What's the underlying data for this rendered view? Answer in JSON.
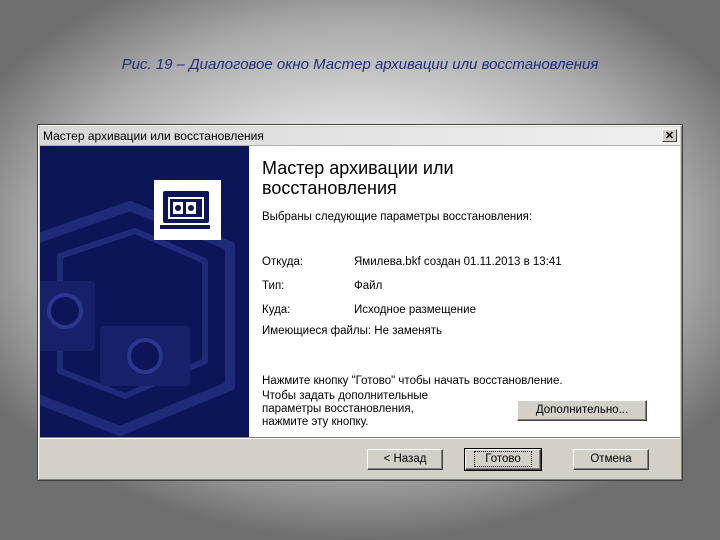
{
  "caption": "Рис. 19 – Диалоговое окно Мастер архивации или восстановления",
  "window": {
    "title": "Мастер архивации или восстановления",
    "close_label": "✕"
  },
  "wizard": {
    "heading_line1": "Мастер архивации или",
    "heading_line2": "восстановления",
    "intro": "Выбраны следующие параметры восстановления:",
    "rows": [
      {
        "label": "Откуда:",
        "value": "Ямилева.bkf создан 01.11.2013 в 13:41"
      },
      {
        "label": "Тип:",
        "value": "Файл"
      },
      {
        "label": "Куда:",
        "value": "Исходное размещение"
      }
    ],
    "existing_files": "Имеющиеся файлы: Не заменять",
    "finish_hint": "Нажмите кнопку \"Готово\" чтобы начать восстановление.",
    "advanced_hint_line1": "Чтобы задать дополнительные",
    "advanced_hint_line2": "параметры восстановления,",
    "advanced_hint_line3": "нажмите эту кнопку.",
    "advanced_button": "Дополнительно..."
  },
  "buttons": {
    "back": "< Назад",
    "finish": "Готово",
    "cancel": "Отмена"
  },
  "colors": {
    "side_panel": "#0c1557",
    "caption": "#1f2f7a"
  },
  "icons": {
    "wizard_logo": "backup-cards-icon",
    "side_decoration": "backup-media-watermark"
  }
}
